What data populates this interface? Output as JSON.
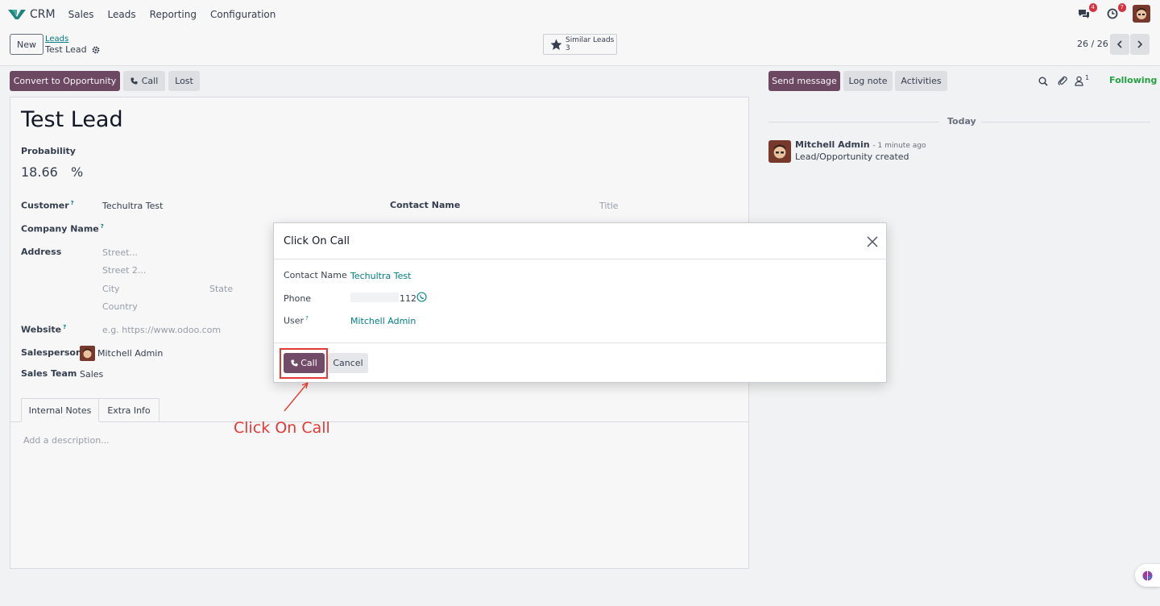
{
  "navbar": {
    "app_name": "CRM",
    "menu": [
      "Sales",
      "Leads",
      "Reporting",
      "Configuration"
    ],
    "messages_count": "4",
    "activities_count": "7"
  },
  "control_panel": {
    "new_label": "New",
    "breadcrumb_parent": "Leads",
    "breadcrumb_current": "Test Lead",
    "similar_label": "Similar Leads",
    "similar_count": "3",
    "pager": "26 / 26"
  },
  "actions": {
    "convert": "Convert to Opportunity",
    "call": "Call",
    "lost": "Lost"
  },
  "form": {
    "title": "Test Lead",
    "probability_label": "Probability",
    "probability_value": "18.66",
    "percent": "%",
    "customer_label": "Customer",
    "customer_value": "Techultra Test",
    "contact_name_label": "Contact Name",
    "title_placeholder": "Title",
    "company_name_label": "Company Name",
    "address_label": "Address",
    "street_placeholder": "Street...",
    "street2_placeholder": "Street 2...",
    "city_placeholder": "City",
    "state_placeholder": "State",
    "country_placeholder": "Country",
    "website_label": "Website",
    "website_placeholder": "e.g. https://www.odoo.com",
    "salesperson_label": "Salesperson",
    "salesperson_value": "Mitchell Admin",
    "sales_team_label": "Sales Team",
    "sales_team_value": "Sales",
    "help_mark": "?",
    "tabs": [
      "Internal Notes",
      "Extra Info"
    ],
    "notes_placeholder": "Add a description..."
  },
  "chatter": {
    "send_message": "Send message",
    "log_note": "Log note",
    "activities": "Activities",
    "followers_count": "1",
    "following": "Following",
    "date_separator": "Today",
    "message_author": "Mitchell Admin",
    "message_time": "- 1 minute ago",
    "message_body": "Lead/Opportunity created"
  },
  "modal": {
    "title": "Click On Call",
    "contact_name_label": "Contact Name",
    "contact_name_value": "Techultra Test",
    "phone_label": "Phone",
    "phone_value": "112",
    "user_label": "User",
    "user_help": "?",
    "user_value": "Mitchell Admin",
    "call_button": "Call",
    "cancel_button": "Cancel"
  },
  "annotation": {
    "text": "Click On Call",
    "color": "#e53935"
  },
  "colors": {
    "primary": "#714b67",
    "link": "#017e84",
    "badge": "#dc3545",
    "following": "#28a745"
  }
}
